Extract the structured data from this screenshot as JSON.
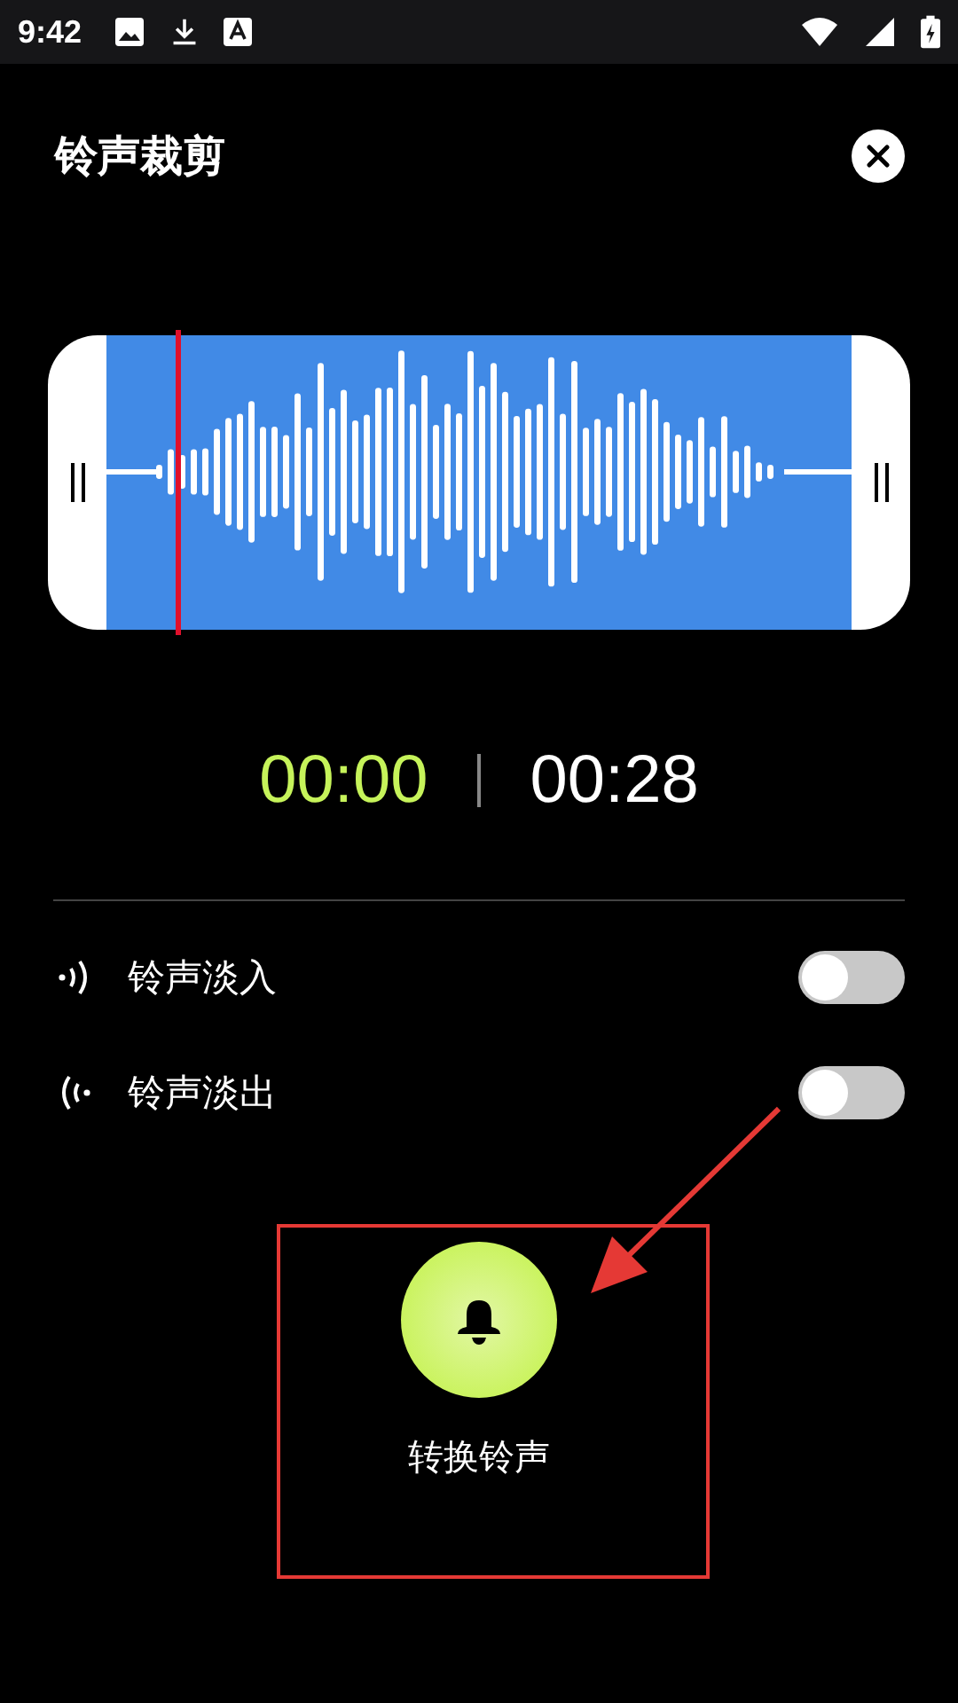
{
  "status_bar": {
    "time": "9:42"
  },
  "header": {
    "title": "铃声裁剪"
  },
  "timer": {
    "start": "00:00",
    "end": "00:28"
  },
  "fades": [
    {
      "kind": "in",
      "label": "铃声淡入",
      "on": false
    },
    {
      "kind": "out",
      "label": "铃声淡出",
      "on": false
    }
  ],
  "action": {
    "label": "转换铃声"
  }
}
